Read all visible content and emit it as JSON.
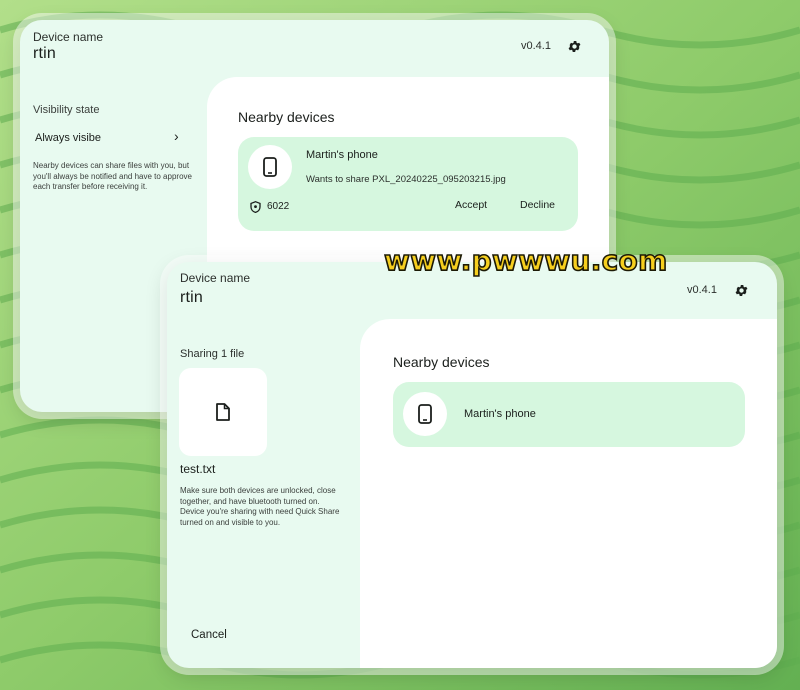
{
  "back_window": {
    "device_label": "Device name",
    "device_name": "rtin",
    "version": "v0.4.1",
    "visibility_label": "Visibility state",
    "visibility_value": "Always visibe",
    "visibility_note": "Nearby devices can share files with you, but you'll always be notified and have to approve each transfer before receiving it.",
    "nearby_title": "Nearby devices",
    "request": {
      "device": "Martin's phone",
      "message": "Wants to share PXL_20240225_095203215.jpg",
      "pin": "6022",
      "accept_label": "Accept",
      "decline_label": "Decline"
    }
  },
  "front_window": {
    "device_label": "Device name",
    "device_name": "rtin",
    "version": "v0.4.1",
    "sharing_label": "Sharing 1 file",
    "file_name": "test.txt",
    "note": "Make sure both devices are unlocked, close together, and have bluetooth turned on. Device you're sharing with need Quick Share turned on and visible to you.",
    "cancel_label": "Cancel",
    "nearby_title": "Nearby devices",
    "devices": [
      {
        "name": "Martin's phone"
      }
    ]
  },
  "watermark": "www.pwwwu.com",
  "colors": {
    "background_green": "#8fca6c",
    "window_bg": "#e8faf0",
    "card_bg": "#d6f7df",
    "watermark": "#f6cf1e"
  }
}
